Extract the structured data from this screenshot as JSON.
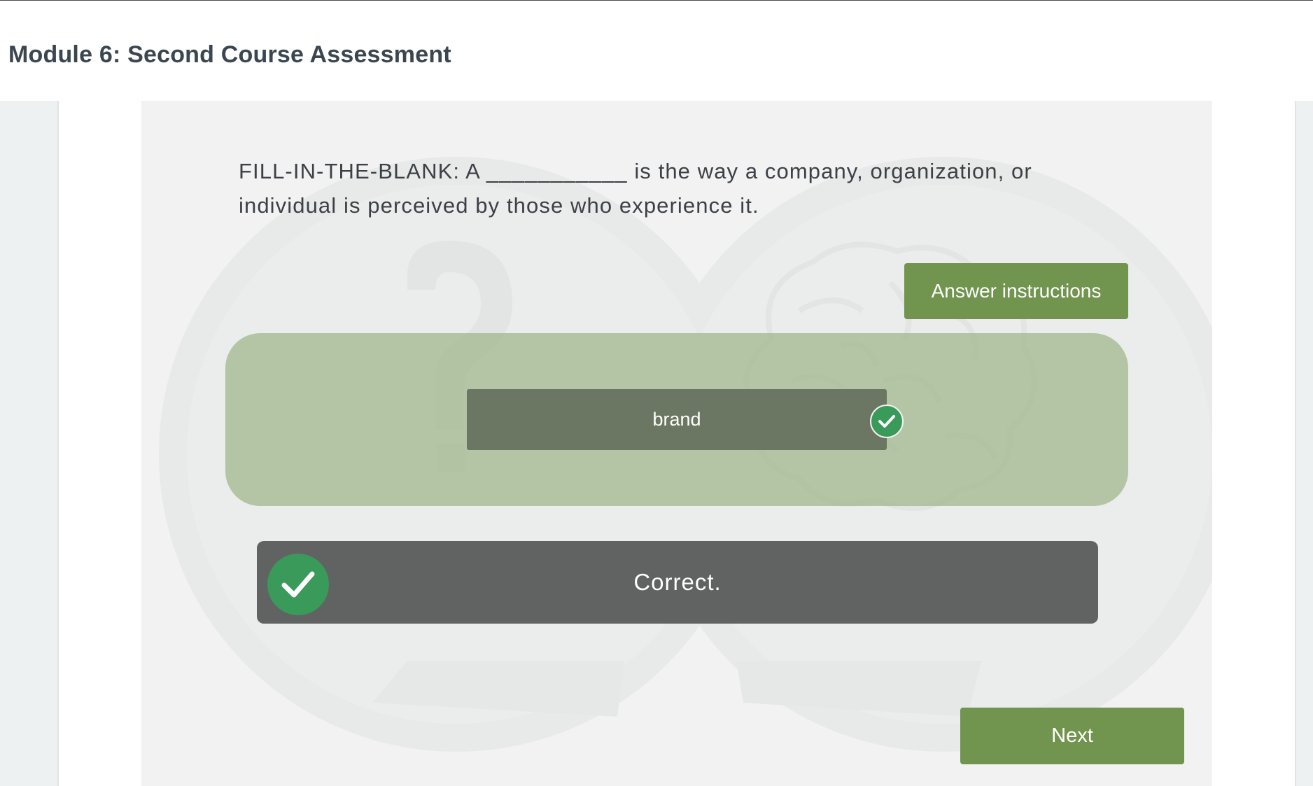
{
  "header": {
    "title": "Module 6: Second Course Assessment"
  },
  "question": {
    "text": "FILL-IN-THE-BLANK: A ___________ is the way a company, organization, or individual is perceived by those who experience it."
  },
  "buttons": {
    "instructions_label": "Answer instructions",
    "next_label": "Next"
  },
  "answer": {
    "value": "brand",
    "status_icon": "check-circle-icon"
  },
  "feedback": {
    "text": "Correct.",
    "icon": "check-circle-icon"
  },
  "colors": {
    "accent_green": "#71944e",
    "success_green": "#3a9a5a",
    "dropzone": "#b2c5a3",
    "feedback_bg": "#616262"
  }
}
